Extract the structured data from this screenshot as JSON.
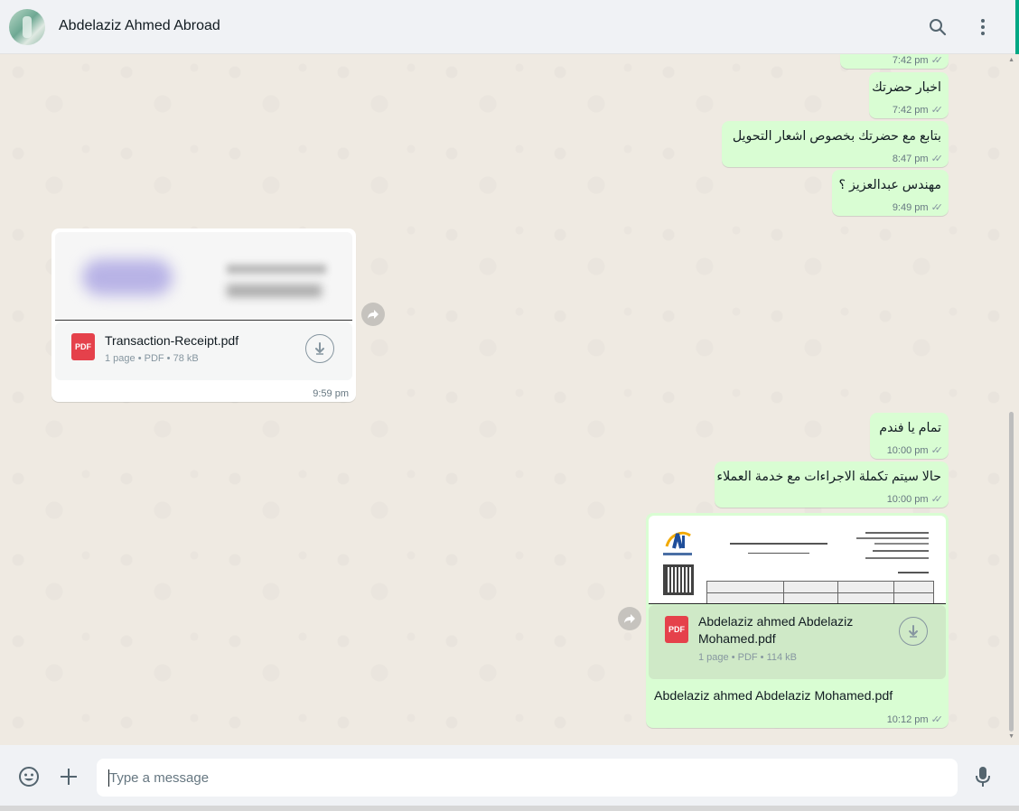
{
  "header": {
    "contact_name": "Abdelaziz Ahmed Abroad",
    "icons": [
      "search-icon",
      "menu-dots-icon"
    ]
  },
  "messages": [
    {
      "direction": "out",
      "text": "",
      "time": "7:42 pm",
      "status": "read"
    },
    {
      "direction": "out",
      "text": "اخبار حضرتك",
      "time": "7:42 pm",
      "status": "read"
    },
    {
      "direction": "out",
      "text": "بتابع مع حضرتك بخصوص اشعار التحويل",
      "time": "8:47 pm",
      "status": "read"
    },
    {
      "direction": "out",
      "text": "مهندس عبدالعزيز ؟",
      "time": "9:49 pm",
      "status": "read"
    },
    {
      "direction": "in",
      "type": "document",
      "file_name": "Transaction-Receipt.pdf",
      "file_info": "1 page • PDF • 78 kB",
      "icon_label": "PDF",
      "time": "9:59 pm"
    },
    {
      "direction": "out",
      "text": "تمام يا فندم",
      "time": "10:00 pm",
      "status": "read"
    },
    {
      "direction": "out",
      "text": "حالا سيتم تكملة الاجراءات مع خدمة العملاء",
      "time": "10:00 pm",
      "status": "read"
    },
    {
      "direction": "out",
      "type": "document",
      "file_name": "Abdelaziz ahmed Abdelaziz Mohamed.pdf",
      "file_name_line1": "Abdelaziz ahmed Abdelaziz",
      "file_name_line2": "Mohamed.pdf",
      "file_info": "1 page • PDF • 114 kB",
      "icon_label": "PDF",
      "caption": "Abdelaziz ahmed Abdelaziz Mohamed.pdf",
      "time": "10:12 pm",
      "status": "read"
    }
  ],
  "composer": {
    "placeholder": "Type a message",
    "value": "",
    "icons": [
      "emoji-icon",
      "attach-plus-icon",
      "microphone-icon"
    ]
  },
  "colors": {
    "outgoing_bubble": "#d9fdd3",
    "incoming_bubble": "#ffffff",
    "pdf_icon": "#e5414b",
    "accent": "#00a884"
  }
}
